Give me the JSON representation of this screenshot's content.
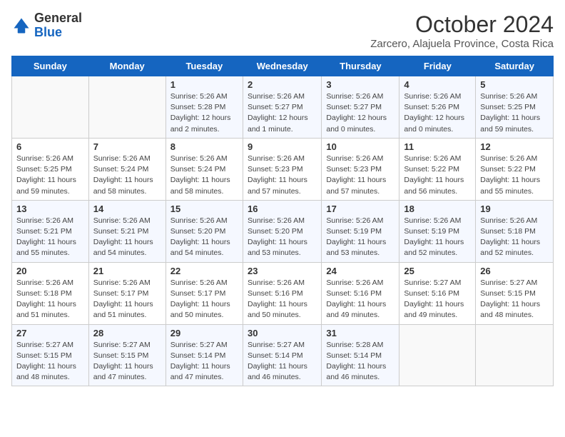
{
  "header": {
    "logo": {
      "general": "General",
      "blue": "Blue"
    },
    "title": "October 2024",
    "subtitle": "Zarcero, Alajuela Province, Costa Rica"
  },
  "days_of_week": [
    "Sunday",
    "Monday",
    "Tuesday",
    "Wednesday",
    "Thursday",
    "Friday",
    "Saturday"
  ],
  "weeks": [
    [
      {
        "day": "",
        "sunrise": "",
        "sunset": "",
        "daylight": ""
      },
      {
        "day": "",
        "sunrise": "",
        "sunset": "",
        "daylight": ""
      },
      {
        "day": "1",
        "sunrise": "Sunrise: 5:26 AM",
        "sunset": "Sunset: 5:28 PM",
        "daylight": "Daylight: 12 hours and 2 minutes."
      },
      {
        "day": "2",
        "sunrise": "Sunrise: 5:26 AM",
        "sunset": "Sunset: 5:27 PM",
        "daylight": "Daylight: 12 hours and 1 minute."
      },
      {
        "day": "3",
        "sunrise": "Sunrise: 5:26 AM",
        "sunset": "Sunset: 5:27 PM",
        "daylight": "Daylight: 12 hours and 0 minutes."
      },
      {
        "day": "4",
        "sunrise": "Sunrise: 5:26 AM",
        "sunset": "Sunset: 5:26 PM",
        "daylight": "Daylight: 12 hours and 0 minutes."
      },
      {
        "day": "5",
        "sunrise": "Sunrise: 5:26 AM",
        "sunset": "Sunset: 5:25 PM",
        "daylight": "Daylight: 11 hours and 59 minutes."
      }
    ],
    [
      {
        "day": "6",
        "sunrise": "Sunrise: 5:26 AM",
        "sunset": "Sunset: 5:25 PM",
        "daylight": "Daylight: 11 hours and 59 minutes."
      },
      {
        "day": "7",
        "sunrise": "Sunrise: 5:26 AM",
        "sunset": "Sunset: 5:24 PM",
        "daylight": "Daylight: 11 hours and 58 minutes."
      },
      {
        "day": "8",
        "sunrise": "Sunrise: 5:26 AM",
        "sunset": "Sunset: 5:24 PM",
        "daylight": "Daylight: 11 hours and 58 minutes."
      },
      {
        "day": "9",
        "sunrise": "Sunrise: 5:26 AM",
        "sunset": "Sunset: 5:23 PM",
        "daylight": "Daylight: 11 hours and 57 minutes."
      },
      {
        "day": "10",
        "sunrise": "Sunrise: 5:26 AM",
        "sunset": "Sunset: 5:23 PM",
        "daylight": "Daylight: 11 hours and 57 minutes."
      },
      {
        "day": "11",
        "sunrise": "Sunrise: 5:26 AM",
        "sunset": "Sunset: 5:22 PM",
        "daylight": "Daylight: 11 hours and 56 minutes."
      },
      {
        "day": "12",
        "sunrise": "Sunrise: 5:26 AM",
        "sunset": "Sunset: 5:22 PM",
        "daylight": "Daylight: 11 hours and 55 minutes."
      }
    ],
    [
      {
        "day": "13",
        "sunrise": "Sunrise: 5:26 AM",
        "sunset": "Sunset: 5:21 PM",
        "daylight": "Daylight: 11 hours and 55 minutes."
      },
      {
        "day": "14",
        "sunrise": "Sunrise: 5:26 AM",
        "sunset": "Sunset: 5:21 PM",
        "daylight": "Daylight: 11 hours and 54 minutes."
      },
      {
        "day": "15",
        "sunrise": "Sunrise: 5:26 AM",
        "sunset": "Sunset: 5:20 PM",
        "daylight": "Daylight: 11 hours and 54 minutes."
      },
      {
        "day": "16",
        "sunrise": "Sunrise: 5:26 AM",
        "sunset": "Sunset: 5:20 PM",
        "daylight": "Daylight: 11 hours and 53 minutes."
      },
      {
        "day": "17",
        "sunrise": "Sunrise: 5:26 AM",
        "sunset": "Sunset: 5:19 PM",
        "daylight": "Daylight: 11 hours and 53 minutes."
      },
      {
        "day": "18",
        "sunrise": "Sunrise: 5:26 AM",
        "sunset": "Sunset: 5:19 PM",
        "daylight": "Daylight: 11 hours and 52 minutes."
      },
      {
        "day": "19",
        "sunrise": "Sunrise: 5:26 AM",
        "sunset": "Sunset: 5:18 PM",
        "daylight": "Daylight: 11 hours and 52 minutes."
      }
    ],
    [
      {
        "day": "20",
        "sunrise": "Sunrise: 5:26 AM",
        "sunset": "Sunset: 5:18 PM",
        "daylight": "Daylight: 11 hours and 51 minutes."
      },
      {
        "day": "21",
        "sunrise": "Sunrise: 5:26 AM",
        "sunset": "Sunset: 5:17 PM",
        "daylight": "Daylight: 11 hours and 51 minutes."
      },
      {
        "day": "22",
        "sunrise": "Sunrise: 5:26 AM",
        "sunset": "Sunset: 5:17 PM",
        "daylight": "Daylight: 11 hours and 50 minutes."
      },
      {
        "day": "23",
        "sunrise": "Sunrise: 5:26 AM",
        "sunset": "Sunset: 5:16 PM",
        "daylight": "Daylight: 11 hours and 50 minutes."
      },
      {
        "day": "24",
        "sunrise": "Sunrise: 5:26 AM",
        "sunset": "Sunset: 5:16 PM",
        "daylight": "Daylight: 11 hours and 49 minutes."
      },
      {
        "day": "25",
        "sunrise": "Sunrise: 5:27 AM",
        "sunset": "Sunset: 5:16 PM",
        "daylight": "Daylight: 11 hours and 49 minutes."
      },
      {
        "day": "26",
        "sunrise": "Sunrise: 5:27 AM",
        "sunset": "Sunset: 5:15 PM",
        "daylight": "Daylight: 11 hours and 48 minutes."
      }
    ],
    [
      {
        "day": "27",
        "sunrise": "Sunrise: 5:27 AM",
        "sunset": "Sunset: 5:15 PM",
        "daylight": "Daylight: 11 hours and 48 minutes."
      },
      {
        "day": "28",
        "sunrise": "Sunrise: 5:27 AM",
        "sunset": "Sunset: 5:15 PM",
        "daylight": "Daylight: 11 hours and 47 minutes."
      },
      {
        "day": "29",
        "sunrise": "Sunrise: 5:27 AM",
        "sunset": "Sunset: 5:14 PM",
        "daylight": "Daylight: 11 hours and 47 minutes."
      },
      {
        "day": "30",
        "sunrise": "Sunrise: 5:27 AM",
        "sunset": "Sunset: 5:14 PM",
        "daylight": "Daylight: 11 hours and 46 minutes."
      },
      {
        "day": "31",
        "sunrise": "Sunrise: 5:28 AM",
        "sunset": "Sunset: 5:14 PM",
        "daylight": "Daylight: 11 hours and 46 minutes."
      },
      {
        "day": "",
        "sunrise": "",
        "sunset": "",
        "daylight": ""
      },
      {
        "day": "",
        "sunrise": "",
        "sunset": "",
        "daylight": ""
      }
    ]
  ]
}
